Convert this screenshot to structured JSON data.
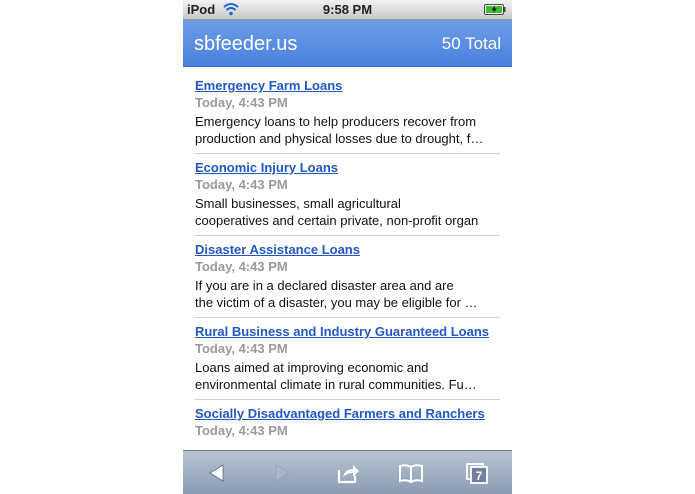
{
  "status_bar": {
    "carrier": "iPod",
    "time": "9:58 PM",
    "icons": [
      "wifi-icon",
      "battery-icon"
    ]
  },
  "header": {
    "title": "sbfeeder.us",
    "total": "50 Total"
  },
  "feed": {
    "items": [
      {
        "title": "Emergency Farm Loans",
        "date": "Today, 4:43 PM",
        "desc_line1": "Emergency loans to help producers recover from",
        "desc_line2": "production and physical losses due to drought, f…"
      },
      {
        "title": "Economic Injury Loans",
        "date": "Today, 4:43 PM",
        "desc_line1": "Small businesses, small agricultural",
        "desc_line2": "cooperatives and certain private, non-profit organ"
      },
      {
        "title": "Disaster Assistance Loans",
        "date": "Today, 4:43 PM",
        "desc_line1": "If you are in a declared disaster area and are",
        "desc_line2": "the victim of a disaster, you may be eligible for …"
      },
      {
        "title": "Rural Business and Industry Guaranteed Loans",
        "date": "Today, 4:43 PM",
        "desc_line1": "Loans aimed at improving economic and",
        "desc_line2": "environmental climate in rural communities. Fu…"
      },
      {
        "title": "Socially Disadvantaged Farmers and Ranchers",
        "date": "Today, 4:43 PM",
        "desc_line1": "",
        "desc_line2": ""
      }
    ]
  },
  "toolbar": {
    "buttons": [
      "back-arrow-icon",
      "forward-arrow-icon",
      "share-icon",
      "bookmarks-icon",
      "pages-icon"
    ],
    "pages_count": "7"
  },
  "colors": {
    "header": "#4a80dd",
    "link": "#2258c2",
    "date": "#9a9a9a",
    "toolbar": "#8a9bb2"
  }
}
